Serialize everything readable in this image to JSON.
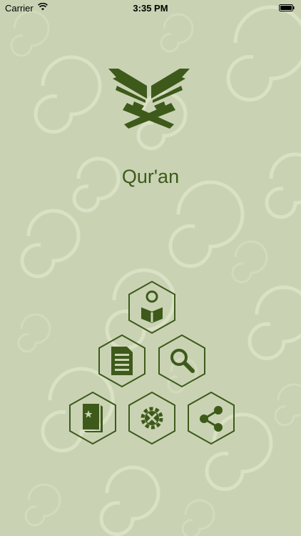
{
  "status_bar": {
    "carrier": "Carrier",
    "time": "3:35 PM",
    "wifi_icon": "wifi-icon",
    "battery_icon": "battery-icon"
  },
  "app": {
    "title": "Qur'an",
    "logo_icon": "quran-book-icon"
  },
  "colors": {
    "background": "#c9d3b4",
    "swirl": "#e0e7cc",
    "accent": "#3e5a1a"
  },
  "menu": [
    {
      "id": "reciter",
      "icon": "reader-icon"
    },
    {
      "id": "contents",
      "icon": "document-icon"
    },
    {
      "id": "search",
      "icon": "search-icon"
    },
    {
      "id": "bookmarks",
      "icon": "bookmark-book-icon"
    },
    {
      "id": "settings",
      "icon": "settings-gear-icon"
    },
    {
      "id": "share",
      "icon": "share-icon"
    }
  ]
}
